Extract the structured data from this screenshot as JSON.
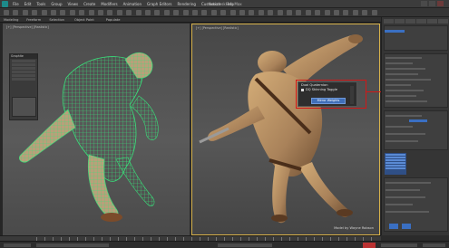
{
  "app": {
    "window_title": "Autodesk 3ds Max",
    "menu": [
      "File",
      "Edit",
      "Tools",
      "Group",
      "Views",
      "Create",
      "Modifiers",
      "Animation",
      "Graph Editors",
      "Rendering",
      "Customize",
      "Help"
    ]
  },
  "ribbon": {
    "tabs": [
      "Modeling",
      "Freeform",
      "Selection",
      "Object Paint",
      "Populate"
    ]
  },
  "viewports": {
    "left_label": "[+] [Perspective] [Realistic]",
    "right_label": "[+] [Perspective] [Realistic]"
  },
  "float_panel": {
    "title": "Graphite"
  },
  "popup": {
    "title": "Dual Quaternion",
    "toggle_label": "DQ Skinning Toggle",
    "button_label": "Mirror Weights",
    "highlight_color": "#d01818",
    "button_color": "#3f6fb8"
  },
  "credit": "Model by Wayne Robson",
  "colors": {
    "wireframe": "#39e07a",
    "skin": "#b08a5a",
    "active_viewport_border": "#d6b14a",
    "selection_blue": "#3a6fc2"
  }
}
